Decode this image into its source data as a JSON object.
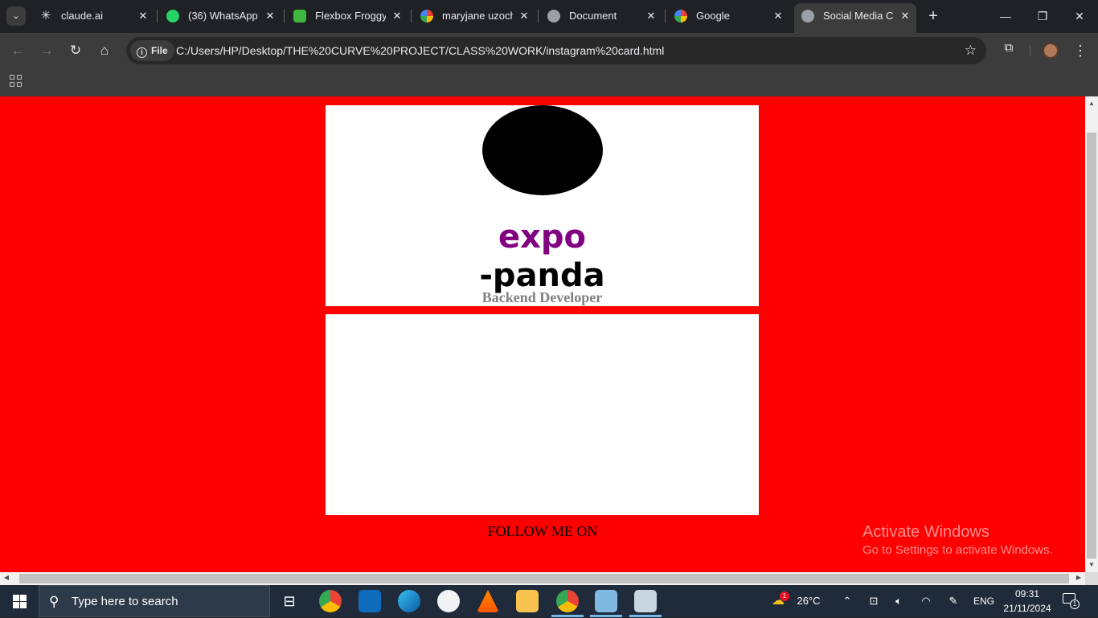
{
  "browser": {
    "tabs": [
      {
        "title": "claude.ai",
        "favicon": "claude-icon"
      },
      {
        "title": "(36) WhatsApp",
        "favicon": "whatsapp-icon"
      },
      {
        "title": "Flexbox Froggy -",
        "favicon": "froggy-icon"
      },
      {
        "title": "maryjane uzochu",
        "favicon": "google-icon"
      },
      {
        "title": "Document",
        "favicon": "globe-icon"
      },
      {
        "title": "Google",
        "favicon": "google-icon"
      },
      {
        "title": "Social Media Car",
        "favicon": "globe-icon",
        "active": true
      }
    ],
    "chip_label": "File",
    "url": "C:/Users/HP/Desktop/THE%20CURVE%20PROJECT/CLASS%20WORK/instagram%20card.html"
  },
  "page": {
    "background_color": "#ff0000",
    "name_line1": "expo",
    "name_line2": "-panda",
    "name_line1_color": "#800080",
    "role": "Backend Developer",
    "follow": "FOLLOW ME ON"
  },
  "watermark": {
    "line1": "Activate Windows",
    "line2": "Go to Settings to activate Windows."
  },
  "taskbar": {
    "search_placeholder": "Type here to search",
    "weather_temp": "26°C",
    "weather_badge": "1",
    "language": "ENG",
    "time": "09:31",
    "date": "21/11/2024",
    "notification_count": "1"
  }
}
